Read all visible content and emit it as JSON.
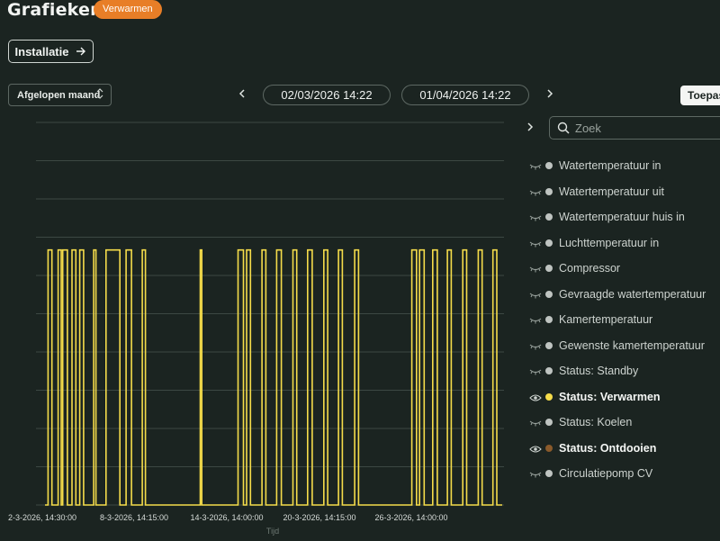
{
  "header": {
    "title": "Grafieken",
    "mode_badge": "Verwarmen",
    "install_button": "Installatie"
  },
  "controls": {
    "period": "Afgelopen maand",
    "start_date": "02/03/2026 14:22",
    "end_date": "01/04/2026 14:22",
    "apply_button": "Toepassen"
  },
  "search": {
    "placeholder": "Zoek"
  },
  "legend": {
    "items": [
      {
        "label": "Watertemperatuur in",
        "visible": false,
        "color": "#bfc4c1"
      },
      {
        "label": "Watertemperatuur uit",
        "visible": false,
        "color": "#bfc4c1"
      },
      {
        "label": "Watertemperatuur huis in",
        "visible": false,
        "color": "#bfc4c1"
      },
      {
        "label": "Luchttemperatuur in",
        "visible": false,
        "color": "#bfc4c1"
      },
      {
        "label": "Compressor",
        "visible": false,
        "color": "#bfc4c1"
      },
      {
        "label": "Gevraagde watertemperatuur",
        "visible": false,
        "color": "#bfc4c1"
      },
      {
        "label": "Kamertemperatuur",
        "visible": false,
        "color": "#bfc4c1"
      },
      {
        "label": "Gewenste kamertemperatuur",
        "visible": false,
        "color": "#bfc4c1"
      },
      {
        "label": "Status: Standby",
        "visible": false,
        "color": "#bfc4c1"
      },
      {
        "label": "Status: Verwarmen",
        "visible": true,
        "color": "#f5dc4a"
      },
      {
        "label": "Status: Koelen",
        "visible": false,
        "color": "#bfc4c1"
      },
      {
        "label": "Status: Ontdooien",
        "visible": true,
        "color": "#8a5a2b"
      },
      {
        "label": "Circulatiepomp CV",
        "visible": false,
        "color": "#bfc4c1"
      }
    ]
  },
  "chart_data": {
    "type": "line",
    "step": true,
    "xlabel": "Tijd",
    "x_tick_labels": [
      "2-3-2026, 14:30:00",
      "8-3-2026, 14:15:00",
      "14-3-2026, 14:00:00",
      "20-3-2026, 14:15:00",
      "26-3-2026, 14:00:00"
    ],
    "x_range_days": [
      0,
      29.6
    ],
    "y_range": [
      0,
      1.5
    ],
    "grid": true,
    "series": [
      {
        "name": "Status: Verwarmen",
        "color": "#f5dc4a",
        "on_intervals_days": [
          [
            0.2,
            0.45
          ],
          [
            0.85,
            1.05
          ],
          [
            1.15,
            1.45
          ],
          [
            1.75,
            2.0
          ],
          [
            2.25,
            2.5
          ],
          [
            3.15,
            3.3
          ],
          [
            3.95,
            4.85
          ],
          [
            5.25,
            5.6
          ],
          [
            6.3,
            6.5
          ],
          [
            10.05,
            10.15
          ],
          [
            12.5,
            12.85
          ],
          [
            13.05,
            13.3
          ],
          [
            14.05,
            14.3
          ],
          [
            15.0,
            15.3
          ],
          [
            16.05,
            16.3
          ],
          [
            17.0,
            17.3
          ],
          [
            18.05,
            18.3
          ],
          [
            19.0,
            19.25
          ],
          [
            20.05,
            20.3
          ],
          [
            23.75,
            24.05
          ],
          [
            24.25,
            24.55
          ],
          [
            25.1,
            25.4
          ],
          [
            26.05,
            26.3
          ],
          [
            27.05,
            27.3
          ],
          [
            28.05,
            28.3
          ],
          [
            29.0,
            29.25
          ]
        ]
      }
    ]
  }
}
